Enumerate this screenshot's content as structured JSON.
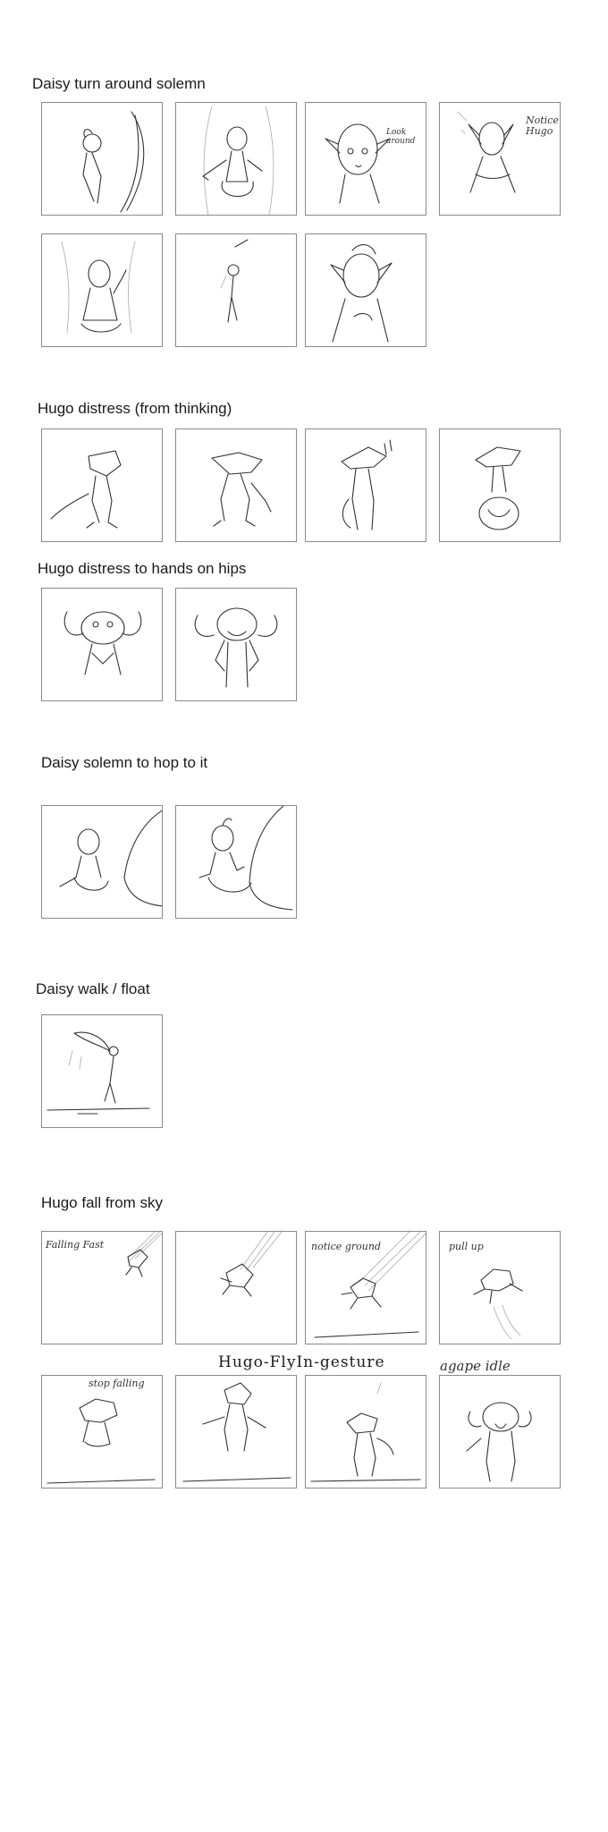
{
  "sections": [
    {
      "title": "Daisy turn around solemn"
    },
    {
      "title": "Hugo distress (from thinking)"
    },
    {
      "title": "Hugo distress to hands on hips"
    },
    {
      "title": "Daisy solemn to hop to it"
    },
    {
      "title": "Daisy walk / float"
    },
    {
      "title": "Hugo fall from sky"
    }
  ],
  "notes": {
    "look_around": "Look around",
    "notice_hugo": "Notice Hugo",
    "falling_fast": "Falling Fast",
    "notice_ground": "notice ground",
    "pull_up": "pull up",
    "stop_falling": "stop falling",
    "fly_in_gesture": "Hugo-FlyIn-gesture",
    "agape_idle": "agape idle"
  }
}
